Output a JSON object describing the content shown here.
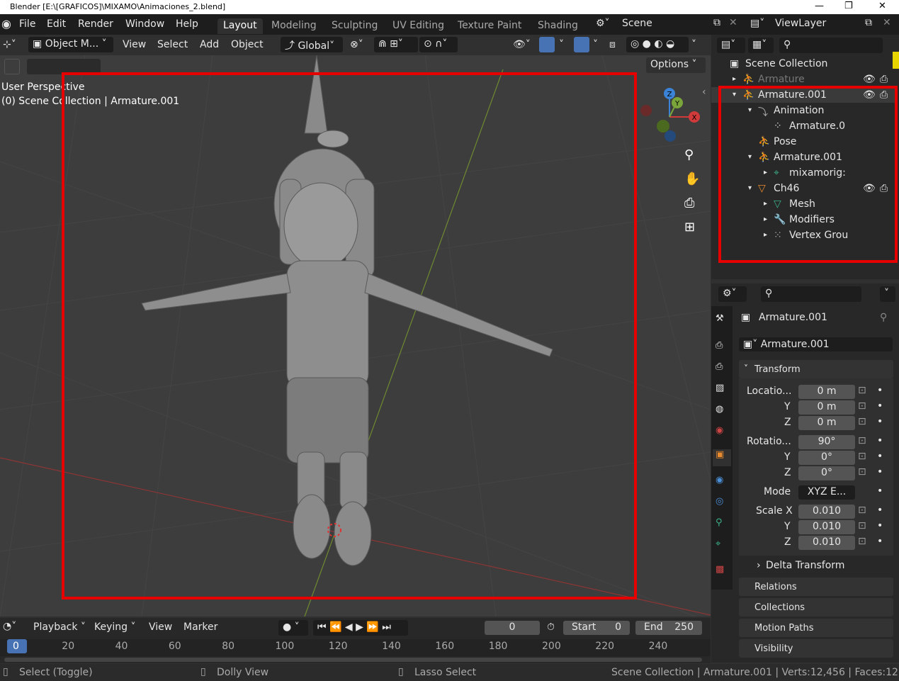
{
  "window": {
    "title": "Blender [E:\\[GRAFICOS]\\MIXAMO\\Animaciones_2.blend]"
  },
  "menu": {
    "file": "File",
    "edit": "Edit",
    "render": "Render",
    "window": "Window",
    "help": "Help"
  },
  "workspaces": [
    "Layout",
    "Modeling",
    "Sculpting",
    "UV Editing",
    "Texture Paint",
    "Shading"
  ],
  "scene": "Scene",
  "view_layer": "ViewLayer",
  "viewport_header": {
    "mode": "Object M...",
    "view": "View",
    "select": "Select",
    "add": "Add",
    "object": "Object",
    "orientation": "Global",
    "options": "Options"
  },
  "viewport": {
    "perspective": "User Perspective",
    "collection_info": "(0) Scene Collection | Armature.001"
  },
  "gizmo": {
    "x": "X",
    "y": "Y",
    "z": "Z"
  },
  "outliner": {
    "root": "Scene Collection",
    "rows": [
      {
        "label": "Armature",
        "indent": 0
      },
      {
        "label": "Armature.001",
        "indent": 0
      },
      {
        "label": "Animation",
        "indent": 1
      },
      {
        "label": "Armature.0",
        "indent": 2
      },
      {
        "label": "Pose",
        "indent": 1
      },
      {
        "label": "Armature.001",
        "indent": 1
      },
      {
        "label": "mixamorig:",
        "indent": 2
      },
      {
        "label": "Ch46",
        "indent": 1
      },
      {
        "label": "Mesh",
        "indent": 2
      },
      {
        "label": "Modifiers",
        "indent": 2
      },
      {
        "label": "Vertex Grou",
        "indent": 2
      }
    ]
  },
  "properties": {
    "object_name": "Armature.001",
    "data_name": "Armature.001",
    "transform_title": "Transform",
    "location_label": "Locatio...",
    "y": "Y",
    "z": "Z",
    "rotation_label": "Rotatio...",
    "mode_label": "Mode",
    "mode_value": "XYZ E...",
    "scale_label": "Scale X",
    "loc": [
      "0 m",
      "0 m",
      "0 m"
    ],
    "rot": [
      "90°",
      "0°",
      "0°"
    ],
    "scale": [
      "0.010",
      "0.010",
      "0.010"
    ],
    "delta": "Delta Transform",
    "relations": "Relations",
    "collections": "Collections",
    "motion_paths": "Motion Paths",
    "visibility": "Visibility"
  },
  "timeline": {
    "playback": "Playback",
    "keying": "Keying",
    "view": "View",
    "marker": "Marker",
    "frame": "0",
    "start_label": "Start",
    "start": "0",
    "end_label": "End",
    "end": "250",
    "ticks": [
      "0",
      "20",
      "40",
      "60",
      "80",
      "100",
      "120",
      "140",
      "160",
      "180",
      "200",
      "220",
      "240"
    ]
  },
  "status": {
    "select": "Select (Toggle)",
    "dolly": "Dolly View",
    "lasso": "Lasso Select",
    "info": "Scene Collection | Armature.001 | Verts:12,456 | Faces:12"
  },
  "colors": {
    "highlight_red": "#e60000",
    "x_axis": "#d03a3a",
    "y_axis": "#7aa53a",
    "z_axis": "#3b83d6"
  }
}
